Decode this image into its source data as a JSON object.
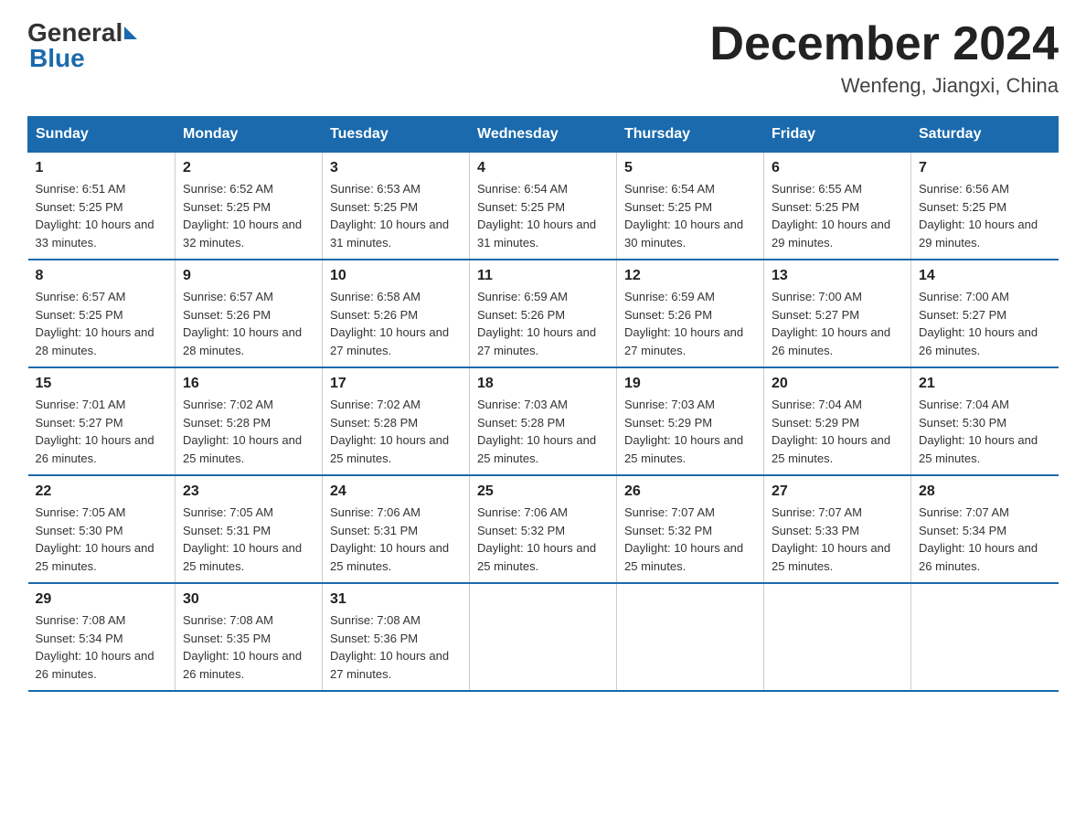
{
  "logo": {
    "general": "General",
    "blue": "Blue"
  },
  "title": {
    "month_year": "December 2024",
    "location": "Wenfeng, Jiangxi, China"
  },
  "days_header": [
    "Sunday",
    "Monday",
    "Tuesday",
    "Wednesday",
    "Thursday",
    "Friday",
    "Saturday"
  ],
  "weeks": [
    [
      {
        "day": "1",
        "sunrise": "6:51 AM",
        "sunset": "5:25 PM",
        "daylight": "10 hours and 33 minutes."
      },
      {
        "day": "2",
        "sunrise": "6:52 AM",
        "sunset": "5:25 PM",
        "daylight": "10 hours and 32 minutes."
      },
      {
        "day": "3",
        "sunrise": "6:53 AM",
        "sunset": "5:25 PM",
        "daylight": "10 hours and 31 minutes."
      },
      {
        "day": "4",
        "sunrise": "6:54 AM",
        "sunset": "5:25 PM",
        "daylight": "10 hours and 31 minutes."
      },
      {
        "day": "5",
        "sunrise": "6:54 AM",
        "sunset": "5:25 PM",
        "daylight": "10 hours and 30 minutes."
      },
      {
        "day": "6",
        "sunrise": "6:55 AM",
        "sunset": "5:25 PM",
        "daylight": "10 hours and 29 minutes."
      },
      {
        "day": "7",
        "sunrise": "6:56 AM",
        "sunset": "5:25 PM",
        "daylight": "10 hours and 29 minutes."
      }
    ],
    [
      {
        "day": "8",
        "sunrise": "6:57 AM",
        "sunset": "5:25 PM",
        "daylight": "10 hours and 28 minutes."
      },
      {
        "day": "9",
        "sunrise": "6:57 AM",
        "sunset": "5:26 PM",
        "daylight": "10 hours and 28 minutes."
      },
      {
        "day": "10",
        "sunrise": "6:58 AM",
        "sunset": "5:26 PM",
        "daylight": "10 hours and 27 minutes."
      },
      {
        "day": "11",
        "sunrise": "6:59 AM",
        "sunset": "5:26 PM",
        "daylight": "10 hours and 27 minutes."
      },
      {
        "day": "12",
        "sunrise": "6:59 AM",
        "sunset": "5:26 PM",
        "daylight": "10 hours and 27 minutes."
      },
      {
        "day": "13",
        "sunrise": "7:00 AM",
        "sunset": "5:27 PM",
        "daylight": "10 hours and 26 minutes."
      },
      {
        "day": "14",
        "sunrise": "7:00 AM",
        "sunset": "5:27 PM",
        "daylight": "10 hours and 26 minutes."
      }
    ],
    [
      {
        "day": "15",
        "sunrise": "7:01 AM",
        "sunset": "5:27 PM",
        "daylight": "10 hours and 26 minutes."
      },
      {
        "day": "16",
        "sunrise": "7:02 AM",
        "sunset": "5:28 PM",
        "daylight": "10 hours and 25 minutes."
      },
      {
        "day": "17",
        "sunrise": "7:02 AM",
        "sunset": "5:28 PM",
        "daylight": "10 hours and 25 minutes."
      },
      {
        "day": "18",
        "sunrise": "7:03 AM",
        "sunset": "5:28 PM",
        "daylight": "10 hours and 25 minutes."
      },
      {
        "day": "19",
        "sunrise": "7:03 AM",
        "sunset": "5:29 PM",
        "daylight": "10 hours and 25 minutes."
      },
      {
        "day": "20",
        "sunrise": "7:04 AM",
        "sunset": "5:29 PM",
        "daylight": "10 hours and 25 minutes."
      },
      {
        "day": "21",
        "sunrise": "7:04 AM",
        "sunset": "5:30 PM",
        "daylight": "10 hours and 25 minutes."
      }
    ],
    [
      {
        "day": "22",
        "sunrise": "7:05 AM",
        "sunset": "5:30 PM",
        "daylight": "10 hours and 25 minutes."
      },
      {
        "day": "23",
        "sunrise": "7:05 AM",
        "sunset": "5:31 PM",
        "daylight": "10 hours and 25 minutes."
      },
      {
        "day": "24",
        "sunrise": "7:06 AM",
        "sunset": "5:31 PM",
        "daylight": "10 hours and 25 minutes."
      },
      {
        "day": "25",
        "sunrise": "7:06 AM",
        "sunset": "5:32 PM",
        "daylight": "10 hours and 25 minutes."
      },
      {
        "day": "26",
        "sunrise": "7:07 AM",
        "sunset": "5:32 PM",
        "daylight": "10 hours and 25 minutes."
      },
      {
        "day": "27",
        "sunrise": "7:07 AM",
        "sunset": "5:33 PM",
        "daylight": "10 hours and 25 minutes."
      },
      {
        "day": "28",
        "sunrise": "7:07 AM",
        "sunset": "5:34 PM",
        "daylight": "10 hours and 26 minutes."
      }
    ],
    [
      {
        "day": "29",
        "sunrise": "7:08 AM",
        "sunset": "5:34 PM",
        "daylight": "10 hours and 26 minutes."
      },
      {
        "day": "30",
        "sunrise": "7:08 AM",
        "sunset": "5:35 PM",
        "daylight": "10 hours and 26 minutes."
      },
      {
        "day": "31",
        "sunrise": "7:08 AM",
        "sunset": "5:36 PM",
        "daylight": "10 hours and 27 minutes."
      },
      null,
      null,
      null,
      null
    ]
  ]
}
